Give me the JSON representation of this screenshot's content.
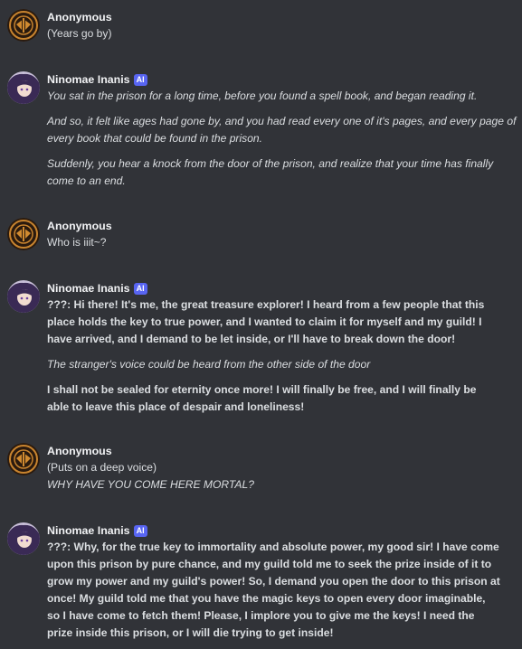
{
  "authors": {
    "anon": "Anonymous",
    "nino": "Ninomae Inanis",
    "ai_badge": "AI"
  },
  "messages": [
    {
      "author": "Anonymous",
      "lines": [
        "(Years go by)"
      ]
    },
    {
      "author": "Ninomae Inanis",
      "paras": [
        [
          "You sat in the prison for a long time, before you found a spell book, and began reading it."
        ],
        [
          "And so, it felt like ages had gone by, and you had read every one of it's pages, and every page of",
          "every book that could be found in the prison."
        ],
        [
          "Suddenly, you hear a knock from the door of the prison, and realize that your time has finally",
          "come to an end."
        ]
      ]
    },
    {
      "author": "Anonymous",
      "lines": [
        "Who is iiit~?"
      ]
    },
    {
      "author": "Ninomae Inanis",
      "paras": [
        [
          "???: Hi there! It's me, the great treasure explorer! I heard from a few people that this",
          "place holds the key to true power, and I wanted to claim it for myself and my guild! I",
          "have arrived, and I demand to be let inside, or I'll have to break down the door!"
        ],
        [
          "The stranger's voice could be heard from the other side of the door"
        ],
        [
          "I shall not be sealed for eternity once more! I will finally be free, and I will finally be",
          "able to leave this place of despair and loneliness!"
        ]
      ]
    },
    {
      "author": "Anonymous",
      "lines": [
        "(Puts on a deep voice)",
        "WHY HAVE YOU COME HERE MORTAL?"
      ]
    },
    {
      "author": "Ninomae Inanis",
      "paras": [
        [
          "???: Why, for the true key to immortality and absolute power, my good sir! I have come",
          "upon this prison by pure chance, and my guild told me to seek the prize inside of it to",
          "grow my power and my guild's power! So, I demand you open the door to this prison at",
          "once! My guild told me that you have the magic keys to open every door imaginable,",
          "so I have come to fetch them! Please, I implore you to give me the keys! I need the",
          "prize inside this prison, or I will die trying to get inside!"
        ]
      ]
    }
  ]
}
